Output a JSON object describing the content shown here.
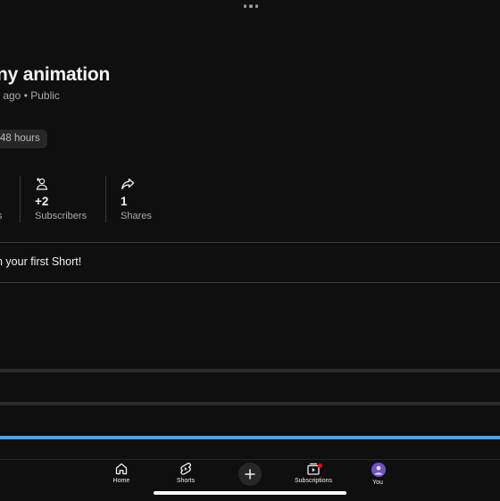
{
  "video": {
    "title": "ny animation",
    "meta": "s ago • Public",
    "chip": "48 hours"
  },
  "stats": [
    {
      "label": "s",
      "value": "",
      "icon": "views-icon"
    },
    {
      "label": "Subscribers",
      "value": "+2",
      "icon": "add-person-icon"
    },
    {
      "label": "Shares",
      "value": "1",
      "icon": "share-icon"
    }
  ],
  "tip": "n your first Short!",
  "nav": {
    "items": [
      {
        "label": "Home",
        "icon": "home-icon"
      },
      {
        "label": "Shorts",
        "icon": "shorts-icon"
      },
      {
        "label": "",
        "icon": "plus-icon"
      },
      {
        "label": "Subscriptions",
        "icon": "subscriptions-icon"
      },
      {
        "label": "You",
        "icon": "avatar"
      }
    ]
  },
  "colors": {
    "background": "#0f0f0f",
    "accent": "#3ea6ff",
    "badge": "#ff0000"
  }
}
